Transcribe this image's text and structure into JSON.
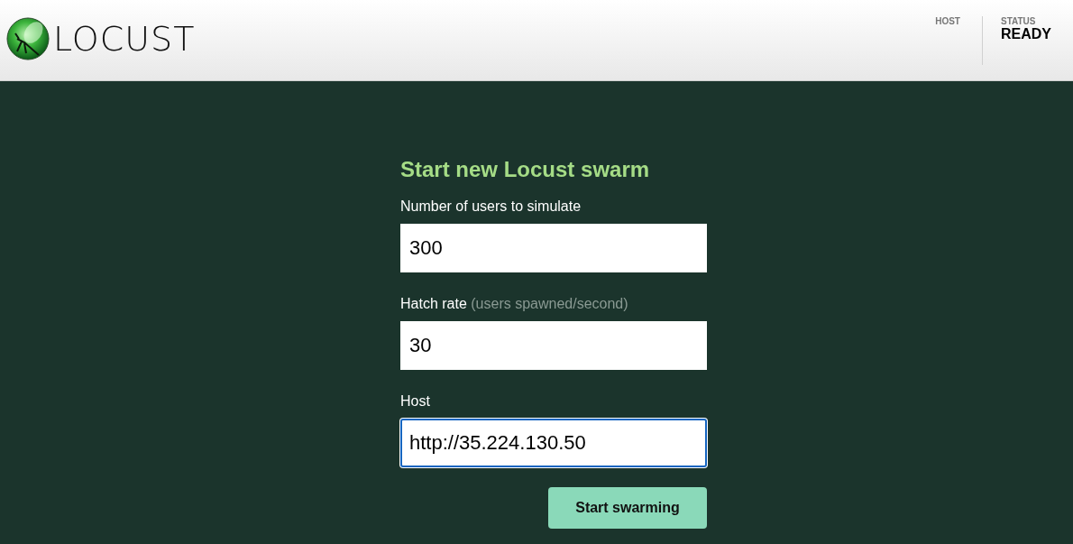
{
  "header": {
    "logo_text": "LOCUST",
    "stats": [
      {
        "label": "HOST"
      },
      {
        "label": "STATUS",
        "value": "READY"
      }
    ]
  },
  "form": {
    "title": "Start new Locust swarm",
    "fields": [
      {
        "label": "Number of users to simulate",
        "value": "300",
        "focused": false
      },
      {
        "label": "Hatch rate",
        "hint": "(users spawned/second)",
        "value": "30",
        "focused": false
      },
      {
        "label": "Host",
        "value": "http://35.224.130.50",
        "focused": true
      }
    ],
    "submit": "Start swarming"
  }
}
